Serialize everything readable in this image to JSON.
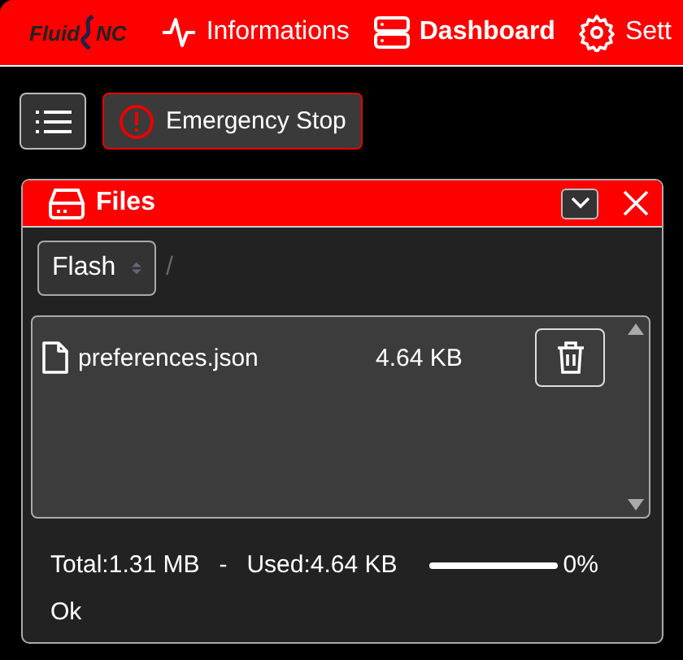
{
  "header": {
    "logo": {
      "left": "Fluid",
      "right": "NC"
    },
    "tabs": [
      {
        "label": "Informations",
        "selected": false
      },
      {
        "label": "Dashboard",
        "selected": true
      },
      {
        "label": "Sett",
        "selected": false
      }
    ]
  },
  "toolbar": {
    "emergency_button": "Emergency Stop"
  },
  "files_panel": {
    "title": "Files",
    "filesystem": "Flash",
    "path": "/",
    "files": [
      {
        "name": "preferences.json",
        "size": "4.64 KB"
      }
    ],
    "total": "Total:1.31 MB",
    "separator": "-",
    "used": "Used:4.64 KB",
    "usage": {
      "level": 0,
      "reading": "0%"
    },
    "status": "Ok"
  }
}
